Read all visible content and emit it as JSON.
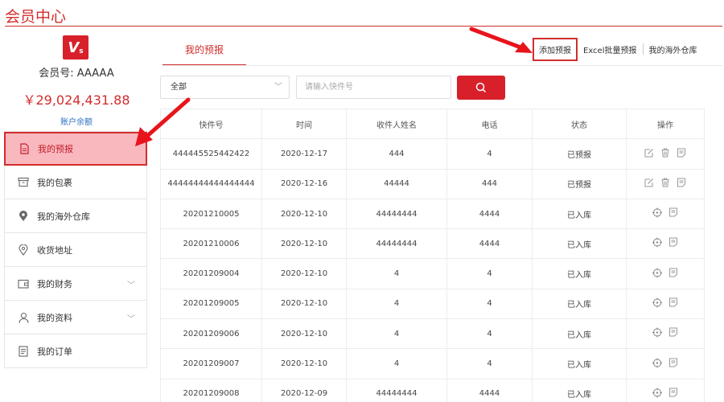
{
  "page": {
    "title": "会员中心"
  },
  "sidebar": {
    "logo_text": "V",
    "logo_sub": "s",
    "member_no": "会员号: AAAAA",
    "balance": "￥29,024,431.88",
    "balance_link": "账户余额",
    "items": [
      {
        "label": "我的预报",
        "icon": "document-icon"
      },
      {
        "label": "我的包裹",
        "icon": "box-icon"
      },
      {
        "label": "我的海外仓库",
        "icon": "location-pin-icon"
      },
      {
        "label": "收货地址",
        "icon": "location-outline-icon"
      },
      {
        "label": "我的财务",
        "icon": "wallet-icon"
      },
      {
        "label": "我的资料",
        "icon": "user-icon"
      },
      {
        "label": "我的订单",
        "icon": "order-list-icon"
      }
    ],
    "expand_glyph": "﹀"
  },
  "tabs": {
    "active": "我的预报"
  },
  "actions": {
    "add_forecast": "添加预报",
    "excel_forecast": "Excel批量预报",
    "overseas_warehouse": "我的海外仓库"
  },
  "search": {
    "select_value": "全部",
    "placeholder": "请输入快件号"
  },
  "table": {
    "headers": [
      "快件号",
      "时间",
      "收件人姓名",
      "电话",
      "状态",
      "操作"
    ],
    "rows": [
      [
        "444445525442422",
        "2020-12-17",
        "444",
        "4",
        "已预报"
      ],
      [
        "44444444444444444",
        "2020-12-16",
        "44444",
        "444",
        "已预报"
      ],
      [
        "20201210005",
        "2020-12-10",
        "44444444",
        "4444",
        "已入库"
      ],
      [
        "20201210006",
        "2020-12-10",
        "44444444",
        "4444",
        "已入库"
      ],
      [
        "20201209004",
        "2020-12-10",
        "4",
        "4",
        "已入库"
      ],
      [
        "20201209005",
        "2020-12-10",
        "4",
        "4",
        "已入库"
      ],
      [
        "20201209006",
        "2020-12-10",
        "4",
        "4",
        "已入库"
      ],
      [
        "20201209007",
        "2020-12-10",
        "4",
        "4",
        "已入库"
      ],
      [
        "20201209008",
        "2020-12-09",
        "44444444",
        "4444",
        "已入库"
      ]
    ]
  },
  "colors": {
    "accent": "#d22d2d",
    "active_bg": "#f9b7be",
    "link": "#2b6fc0"
  }
}
